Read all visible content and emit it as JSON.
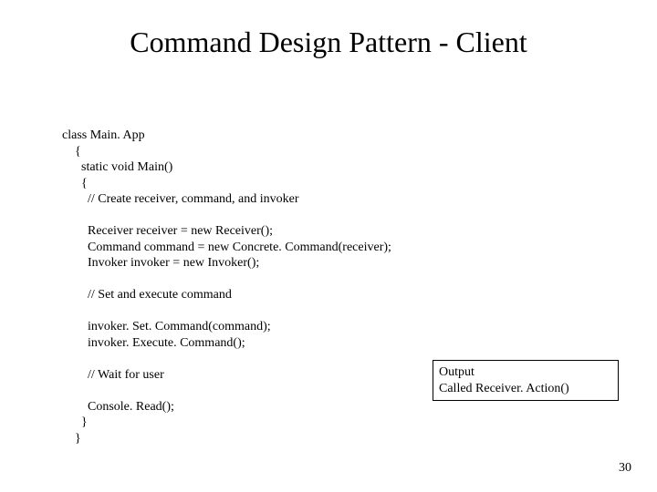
{
  "title": "Command Design Pattern - Client",
  "code": "class Main. App\n    {\n      static void Main()\n      {\n        // Create receiver, command, and invoker\n\n        Receiver receiver = new Receiver();\n        Command command = new Concrete. Command(receiver);\n        Invoker invoker = new Invoker();\n\n        // Set and execute command\n\n        invoker. Set. Command(command);\n        invoker. Execute. Command();\n\n        // Wait for user\n\n        Console. Read();\n      }\n    }",
  "output": "Output\nCalled Receiver. Action()",
  "page_number": "30"
}
